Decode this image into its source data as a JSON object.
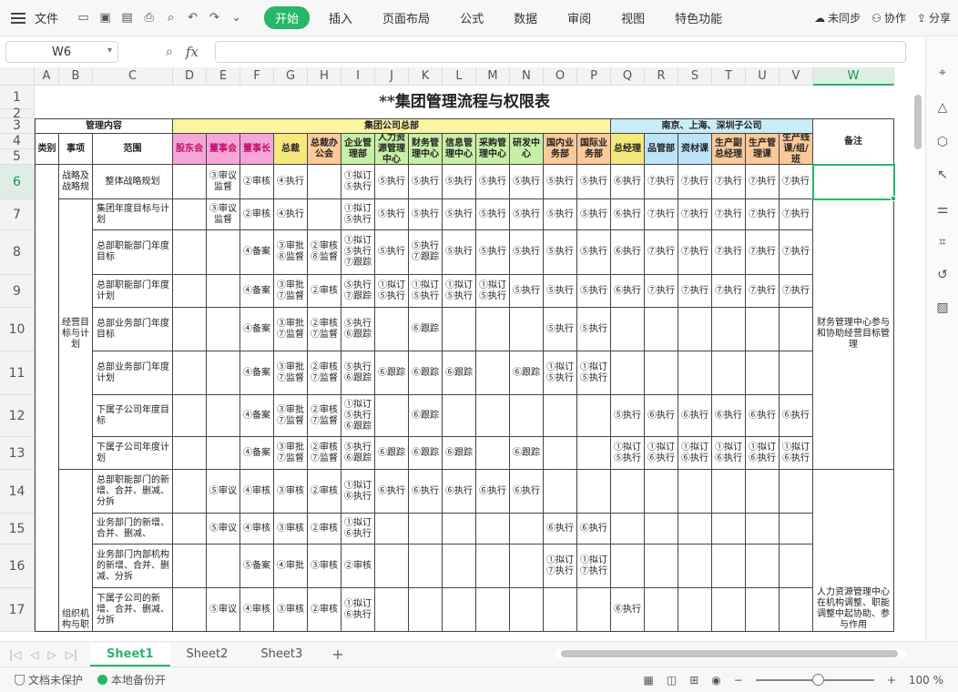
{
  "topbar": {
    "file_label": "文件",
    "tabs": [
      "开始",
      "插入",
      "页面布局",
      "公式",
      "数据",
      "审阅",
      "视图",
      "特色功能"
    ],
    "active_tab": "开始",
    "right": {
      "unsync": "未同步",
      "collab": "协作",
      "share": "分享"
    }
  },
  "formula": {
    "cell_ref": "W6",
    "fx": "fx",
    "value": ""
  },
  "columns": [
    "A",
    "B",
    "C",
    "D",
    "E",
    "F",
    "G",
    "H",
    "I",
    "J",
    "K",
    "L",
    "M",
    "N",
    "O",
    "P",
    "Q",
    "R",
    "S",
    "T",
    "U",
    "V",
    "W"
  ],
  "rows": [
    "1",
    "2",
    "3",
    "4",
    "5",
    "6",
    "7",
    "8",
    "9",
    "10",
    "11",
    "12",
    "13",
    "14",
    "15",
    "16",
    "17"
  ],
  "sheet": {
    "title": "**集团管理流程与权限表",
    "mgmt_content": "管理内容",
    "hq": "集团公司总部",
    "subs": "南京、上海、深圳子公司",
    "remark": "备注",
    "h_type": "类别",
    "h_item": "事项",
    "h_scope": "范围",
    "dept_headers": [
      "股东会",
      "董事会",
      "董事长",
      "总裁",
      "总裁办公会",
      "企业管理部",
      "人力资源管理中心",
      "财务管理中心",
      "信息管理中心",
      "采购管理中心",
      "研发中心",
      "国内业务部",
      "国际业务部",
      "总经理",
      "品管部",
      "资材课",
      "生产副总经理",
      "生产管理课",
      "生产线课/组/班"
    ],
    "cat_strategy": "战略及战略规",
    "cat_oper": "经营目标与计划",
    "cat_org": "组织机构与职",
    "remark_oper": "财务管理中心参与和协助经营目标管理",
    "remark_org": "人力资源管理中心在机构调整、职能调整中起协助、参与作用",
    "scopes": [
      "整体战略规划",
      "集团年度目标与计划",
      "总部职能部门年度目标",
      "总部职能部门年度计划",
      "总部业务部门年度目标",
      "总部业务部门年度计划",
      "下属子公司年度目标",
      "下属子公司年度计划",
      "总部职能部门的新增、合并、删减、分拆",
      "业务部门的新增、合并、删减、",
      "业务部门内部机构的新增、合并、删减、分拆",
      "下属子公司的新增、合并、删减、分拆"
    ],
    "data_rows": [
      [
        "",
        "③审议监督",
        "②审核",
        "④执行",
        "",
        "①拟订⑤执行",
        "⑤执行",
        "⑤执行",
        "⑤执行",
        "⑤执行",
        "⑤执行",
        "⑤执行",
        "⑤执行",
        "⑥执行",
        "⑦执行",
        "⑦执行",
        "⑦执行",
        "⑦执行",
        "⑦执行"
      ],
      [
        "",
        "③审议监督",
        "②审核",
        "④执行",
        "",
        "①拟订⑤执行",
        "⑤执行",
        "⑤执行",
        "⑤执行",
        "⑤执行",
        "⑤执行",
        "⑤执行",
        "⑤执行",
        "⑥执行",
        "⑦执行",
        "⑦执行",
        "⑦执行",
        "⑦执行",
        "⑦执行"
      ],
      [
        "",
        "",
        "④备案",
        "③审批⑧监督",
        "②审核⑧监督",
        "①拟订⑤执行⑦跟踪",
        "⑤执行",
        "⑤执行⑦跟踪",
        "⑤执行",
        "⑤执行",
        "⑤执行",
        "⑤执行",
        "⑤执行",
        "⑥执行",
        "⑦执行",
        "⑦执行",
        "⑦执行",
        "⑦执行",
        "⑦执行"
      ],
      [
        "",
        "",
        "④备案",
        "③审批⑦监督",
        "②审核",
        "⑤执行⑦跟踪",
        "①拟订⑤执行",
        "①拟订⑤执行",
        "①拟订⑤执行",
        "①拟订⑤执行",
        "⑤执行",
        "⑤执行",
        "⑤执行",
        "⑥执行",
        "⑦执行",
        "⑦执行",
        "⑦执行",
        "⑦执行",
        "⑦执行"
      ],
      [
        "",
        "",
        "④备案",
        "③审批⑦监督",
        "②审核⑦监督",
        "⑤执行⑥跟踪",
        "",
        "⑥跟踪",
        "",
        "",
        "",
        "⑤执行",
        "⑤执行",
        "",
        "",
        "",
        "",
        "",
        ""
      ],
      [
        "",
        "",
        "④备案",
        "③审批⑦监督",
        "②审核⑦监督",
        "⑤执行⑥跟踪",
        "⑥跟踪",
        "⑥跟踪",
        "⑥跟踪",
        "",
        "⑥跟踪",
        "①拟订⑤执行",
        "①拟订⑤执行",
        "",
        "",
        "",
        "",
        "",
        ""
      ],
      [
        "",
        "",
        "④备案",
        "③审批⑦监督",
        "②审核⑦监督",
        "①拟订⑤执行⑥跟踪",
        "",
        "⑥跟踪",
        "",
        "",
        "",
        "",
        "",
        "⑤执行",
        "⑥执行",
        "⑥执行",
        "⑥执行",
        "⑥执行",
        "⑥执行"
      ],
      [
        "",
        "",
        "④备案",
        "③审批⑦监督",
        "②审核⑦监督",
        "⑤执行⑥跟踪",
        "⑥跟踪",
        "⑥跟踪",
        "⑥跟踪",
        "",
        "⑥跟踪",
        "",
        "",
        "①拟订⑤执行",
        "①拟订⑥执行",
        "①拟订⑥执行",
        "①拟订⑥执行",
        "①拟订⑥执行",
        "①拟订⑥执行"
      ],
      [
        "",
        "⑤审议",
        "④审核",
        "③审核",
        "②审核",
        "①拟订⑥执行",
        "⑥执行",
        "⑥执行",
        "⑥执行",
        "⑥执行",
        "⑥执行",
        "",
        "",
        "",
        "",
        "",
        "",
        "",
        ""
      ],
      [
        "",
        "⑤审议",
        "④审核",
        "③审核",
        "②审核",
        "①拟订⑥执行",
        "",
        "",
        "",
        "",
        "",
        "⑥执行",
        "⑥执行",
        "",
        "",
        "",
        "",
        "",
        ""
      ],
      [
        "",
        "",
        "⑤备案",
        "④审批",
        "③审核",
        "②审核",
        "",
        "",
        "",
        "",
        "",
        "①拟订⑦执行",
        "①拟订⑦执行",
        "",
        "",
        "",
        "",
        "",
        ""
      ],
      [
        "",
        "⑤审议",
        "④审核",
        "③审核",
        "②审核",
        "①拟订⑥执行",
        "",
        "",
        "",
        "",
        "",
        "",
        "",
        "⑥执行",
        "",
        "",
        "",
        "",
        ""
      ]
    ]
  },
  "sheets": [
    "Sheet1",
    "Sheet2",
    "Sheet3"
  ],
  "active_sheet": "Sheet1",
  "status": {
    "protect": "文档未保护",
    "backup": "本地备份开",
    "zoom": "100 %"
  }
}
